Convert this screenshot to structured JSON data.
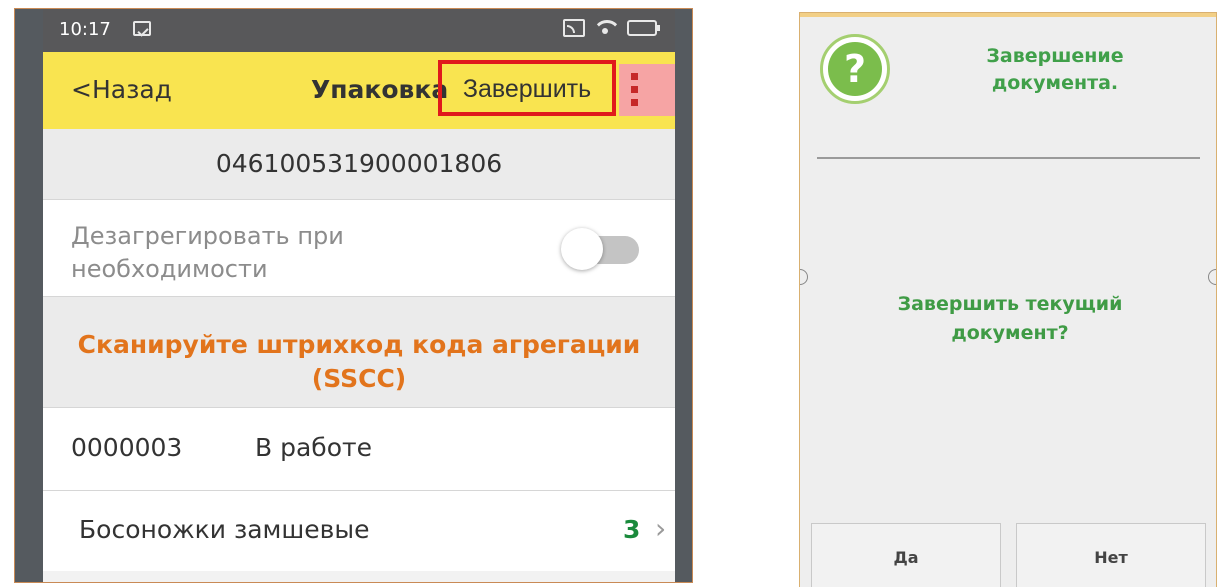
{
  "phone": {
    "status_bar": {
      "time": "10:17"
    },
    "toolbar": {
      "back_label": "<Назад",
      "title": "Упаковка",
      "finish_label": "Завершить",
      "highlight_color": "#e0191c"
    },
    "barcode": "046100531900001806",
    "option": {
      "label": "Дезагрегировать при необходимости",
      "toggle_on": false
    },
    "scan_prompt": "Сканируйте штрихкод кода агрегации (SSCC)",
    "document": {
      "number": "0000003",
      "status": "В работе"
    },
    "items": [
      {
        "name": "Босоножки замшевые",
        "qty": "3"
      }
    ],
    "colors": {
      "toolbar": "#f9e450",
      "prompt": "#e2741c",
      "qty": "#1a8a3c"
    }
  },
  "dialog": {
    "icon": "question-icon",
    "title": "Завершение документа.",
    "question": "Завершить текущий документ?",
    "yes_label": "Да",
    "no_label": "Нет",
    "colors": {
      "text": "#40a04a",
      "icon": "#7bbd4c"
    }
  }
}
